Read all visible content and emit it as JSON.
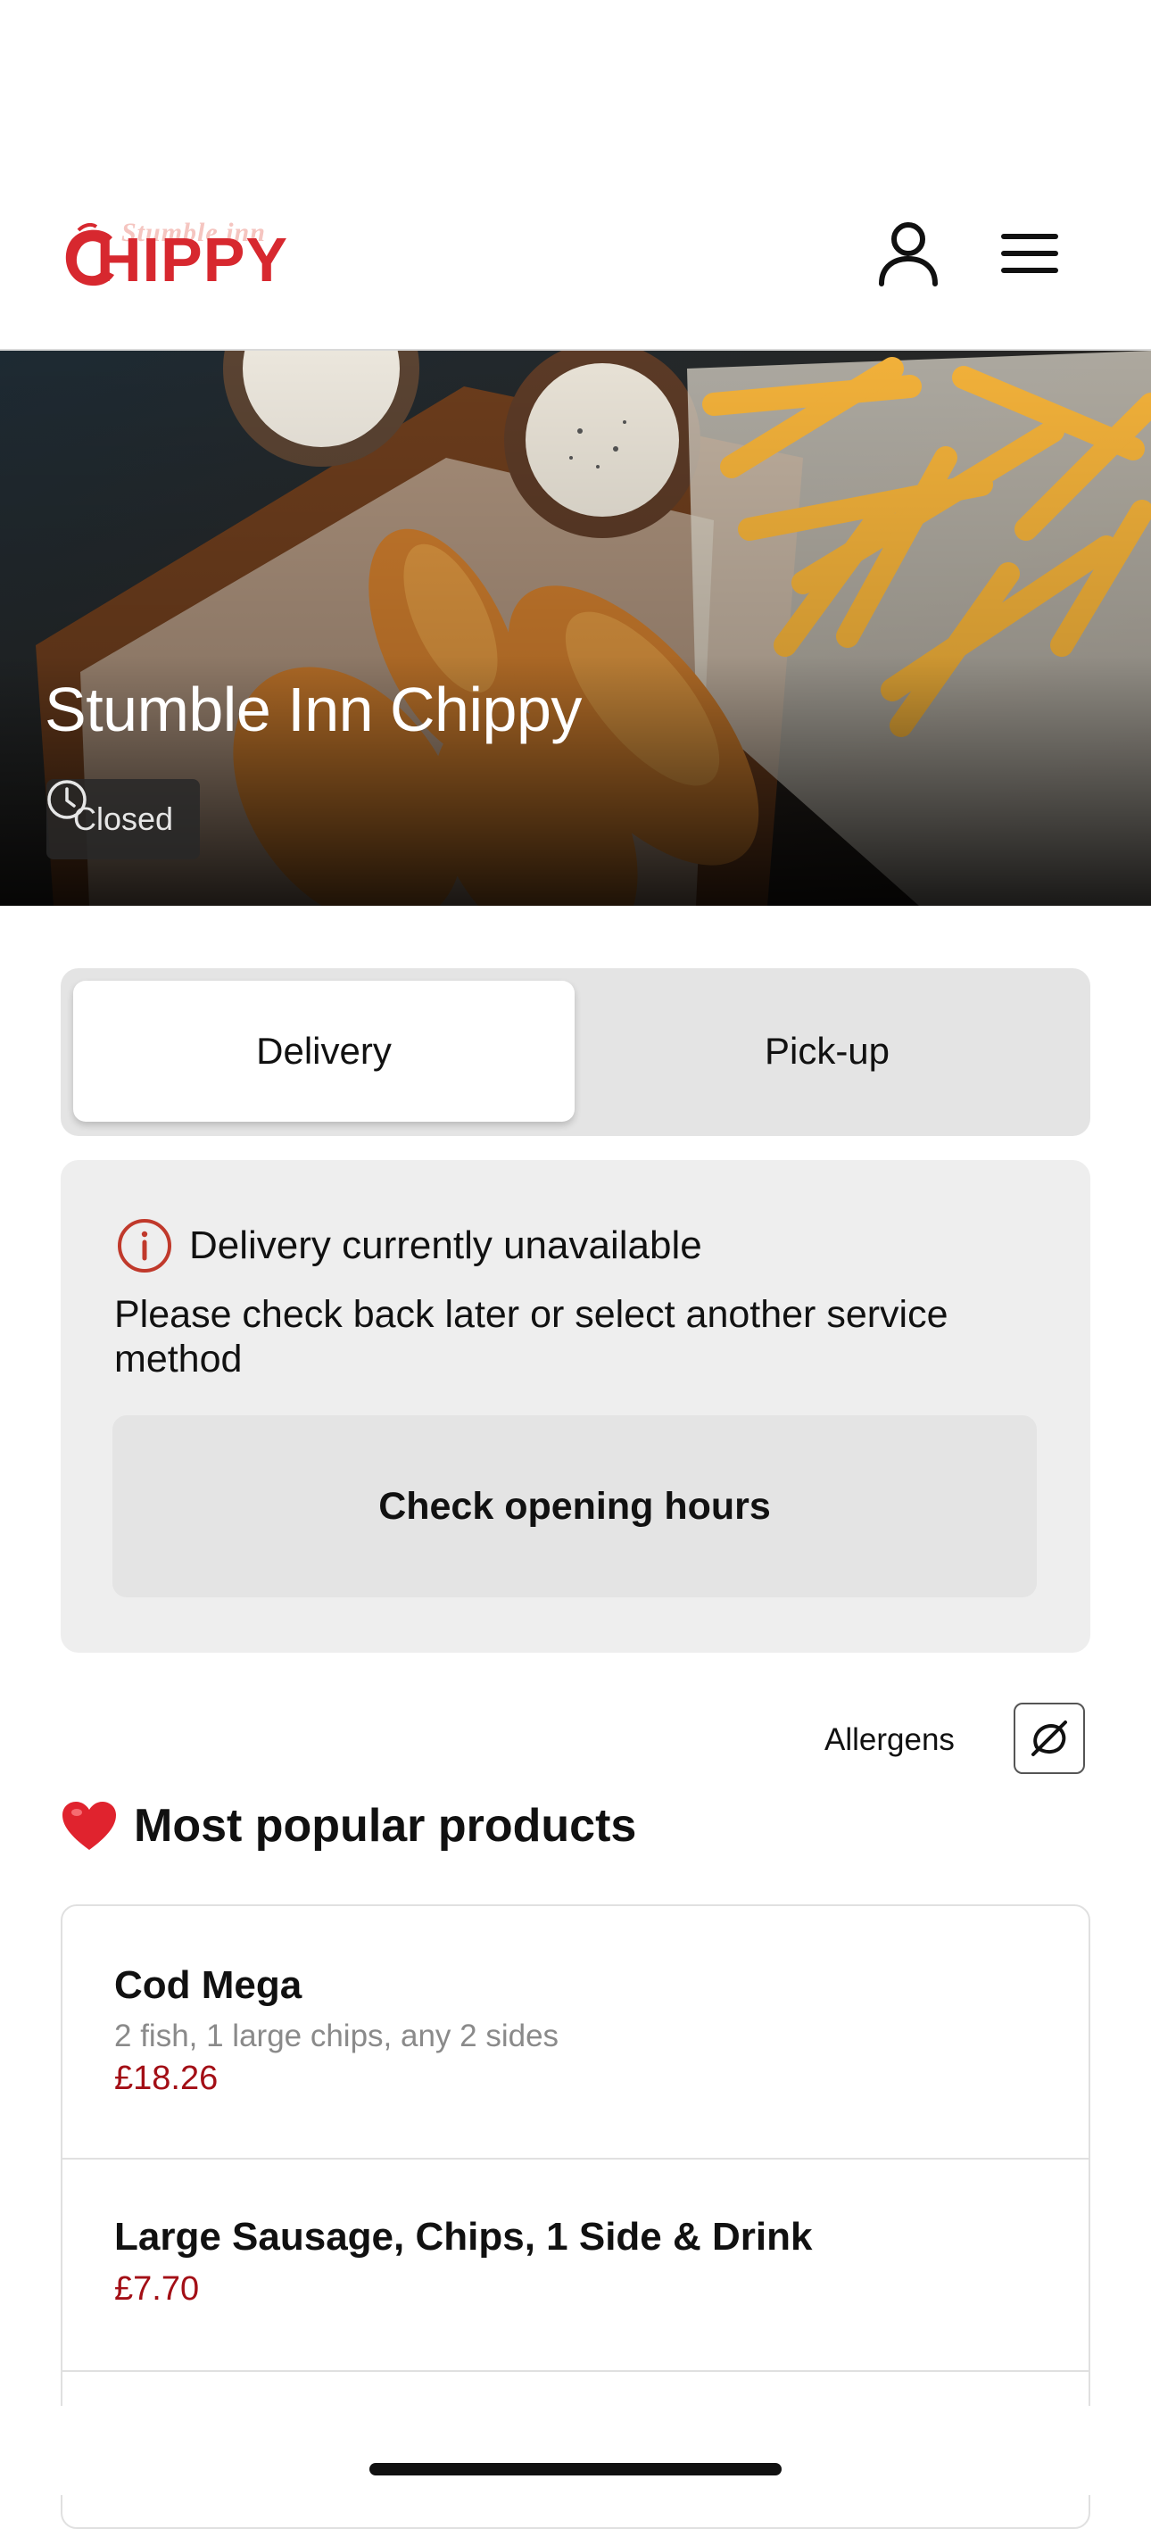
{
  "brand": {
    "logo_small": "Stumble inn",
    "logo_big": "HIPPY",
    "accent": "#d7282f"
  },
  "header": {
    "account_icon": "user-icon",
    "menu_icon": "hamburger-menu-icon"
  },
  "hero": {
    "title": "Stumble Inn Chippy",
    "status": "Closed",
    "status_icon": "clock-icon"
  },
  "service": {
    "tabs": [
      {
        "label": "Delivery",
        "selected": true
      },
      {
        "label": "Pick-up",
        "selected": false
      }
    ]
  },
  "notice": {
    "icon": "info-icon",
    "title": "Delivery currently unavailable",
    "body": "Please check back later or select another service method",
    "button": "Check opening hours"
  },
  "allergens": {
    "label": "Allergens",
    "icon": "allergen-filter-icon"
  },
  "popular": {
    "emoji": "❤️",
    "title": "Most popular products",
    "items": [
      {
        "name": "Cod Mega",
        "description": "2 fish, 1 large chips, any 2 sides",
        "price": "£18.26"
      },
      {
        "name": "Large Sausage, Chips, 1 Side & Drink",
        "price": "£7.70"
      }
    ]
  },
  "colors": {
    "price": "#a30f16",
    "info_icon": "#c0392b"
  }
}
